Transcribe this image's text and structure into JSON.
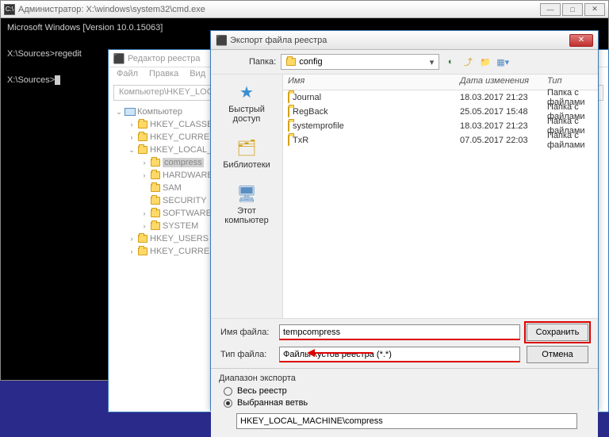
{
  "cmd": {
    "title": "Администратор: X:\\windows\\system32\\cmd.exe",
    "lines": {
      "l1": "Microsoft Windows [Version 10.0.15063]",
      "l2": "X:\\Sources>regedit",
      "l3": "X:\\Sources>"
    }
  },
  "regedit": {
    "title": "Редактор реестра",
    "menu": {
      "file": "Файл",
      "edit": "Правка",
      "view": "Вид"
    },
    "address": "Компьютер\\HKEY_LOCAL_MACHINE\\compress",
    "tree": {
      "root": "Компьютер",
      "classes": "HKEY_CLASSES_ROOT",
      "current_user": "HKEY_CURRENT_USER",
      "local": "HKEY_LOCAL_MACHINE",
      "compress": "compress",
      "hardware": "HARDWARE",
      "sam": "SAM",
      "security": "SECURITY",
      "software": "SOFTWARE",
      "system": "SYSTEM",
      "users": "HKEY_USERS",
      "current_config": "HKEY_CURRENT_CONFIG"
    }
  },
  "export": {
    "title": "Экспорт файла реестра",
    "folder_label": "Папка:",
    "folder_value": "config",
    "side": {
      "quick": "Быстрый доступ",
      "libs": "Библиотеки",
      "pc": "Этот компьютер"
    },
    "cols": {
      "name": "Имя",
      "date": "Дата изменения",
      "type": "Тип"
    },
    "rows": [
      {
        "name": "Journal",
        "date": "18.03.2017 21:23",
        "type": "Папка с файлами"
      },
      {
        "name": "RegBack",
        "date": "25.05.2017 15:48",
        "type": "Папка с файлами"
      },
      {
        "name": "systemprofile",
        "date": "18.03.2017 21:23",
        "type": "Папка с файлами"
      },
      {
        "name": "TxR",
        "date": "07.05.2017 22:03",
        "type": "Папка с файлами"
      }
    ],
    "filename_label": "Имя файла:",
    "filename_value": "tempcompress",
    "filetype_label": "Тип файла:",
    "filetype_value": "Файлы кустов реестра (*.*)",
    "save": "Сохранить",
    "cancel": "Отмена",
    "range_title": "Диапазон экспорта",
    "range_all": "Весь реестр",
    "range_branch": "Выбранная ветвь",
    "branch_value": "HKEY_LOCAL_MACHINE\\compress"
  }
}
